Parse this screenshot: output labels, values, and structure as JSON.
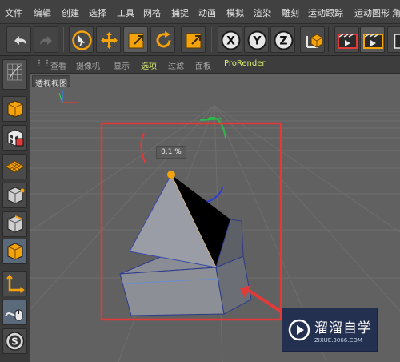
{
  "menu": [
    "文件",
    "编辑",
    "创建",
    "选择",
    "工具",
    "网格",
    "捕捉",
    "动画",
    "模拟",
    "渲染",
    "雕刻",
    "运动跟踪",
    "运动图形",
    "角"
  ],
  "toolbar": {
    "undo": "undo-icon",
    "redo": "redo-icon",
    "select": "live-selection-icon",
    "move": "move-icon",
    "scale": "scale-icon",
    "rotate": "rotate-icon",
    "last_tool": "scale-icon",
    "axis_x": "X",
    "axis_y": "Y",
    "axis_z": "Z",
    "coord": "coordinate-system-icon",
    "render_region": "render-region-icon",
    "render_view": "render-view-icon",
    "render_settings": "render-settings-icon"
  },
  "viewport_menu": [
    "查看",
    "摄像机",
    "显示",
    "选项",
    "过滤",
    "面板",
    "ProRender"
  ],
  "viewport": {
    "label": "透视视图",
    "tooltip": "0.1 %"
  },
  "colors": {
    "accent_orange": "#f4a30b",
    "highlight_red": "#e03a3a",
    "viewport_bg": "#616161",
    "yellow_menu": "#d9f070"
  },
  "watermark": {
    "title": "溜溜自学",
    "subtitle": "ZIXUE.3066.COM"
  }
}
